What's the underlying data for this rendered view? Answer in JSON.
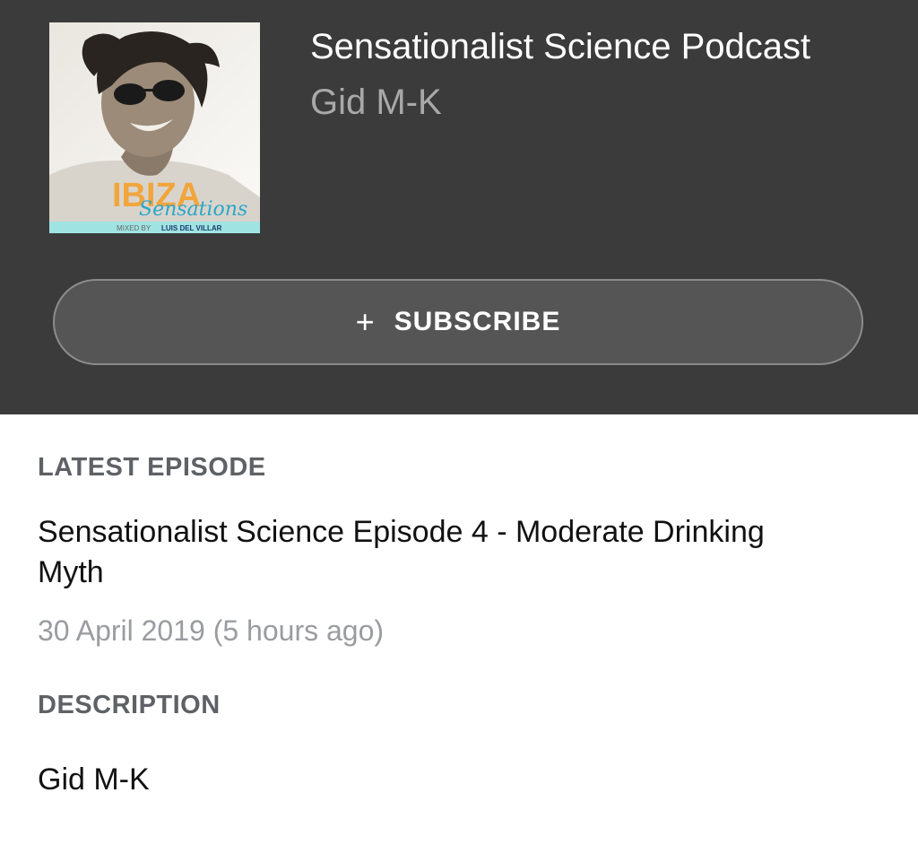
{
  "podcast": {
    "title": "Sensationalist Science Podcast",
    "author": "Gid M-K",
    "artwork": {
      "logo_text": "IBIZA",
      "script_text": "Sensations",
      "mixed_by": "MIXED BY",
      "dj_name": "LUIS DEL VILLAR"
    }
  },
  "subscribe": {
    "icon": "plus-icon",
    "icon_glyph": "+",
    "label": "SUBSCRIBE"
  },
  "latest_episode": {
    "heading": "LATEST EPISODE",
    "title": "Sensationalist Science Episode 4 - Moderate Drinking Myth",
    "date": "30 April 2019 (5 hours ago)"
  },
  "description": {
    "heading": "DESCRIPTION",
    "text": "Gid M-K"
  },
  "colors": {
    "header_bg": "#3b3b3b",
    "button_bg": "#555555",
    "heading_gray": "#5e6166",
    "date_gray": "#9a9ca1"
  }
}
